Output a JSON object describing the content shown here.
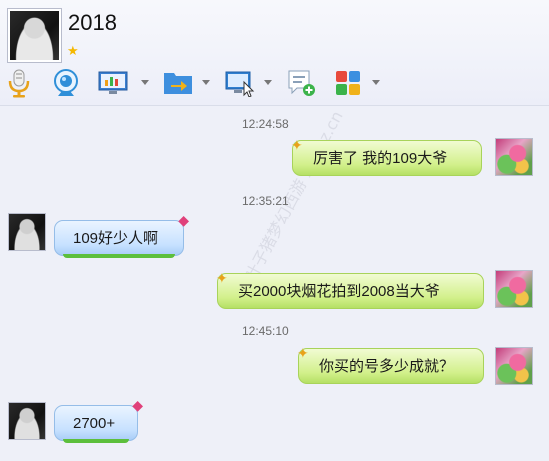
{
  "header": {
    "contact_name": "2018",
    "status_icon": "star-icon"
  },
  "toolbar": {
    "items": [
      {
        "name": "microphone-icon",
        "has_menu": false
      },
      {
        "name": "webcam-icon",
        "has_menu": false
      },
      {
        "name": "screen-share-icon",
        "has_menu": true
      },
      {
        "name": "send-file-icon",
        "has_menu": true
      },
      {
        "name": "remote-desktop-icon",
        "has_menu": true
      },
      {
        "name": "create-discussion-icon",
        "has_menu": false
      },
      {
        "name": "apps-icon",
        "has_menu": true
      }
    ]
  },
  "messages": [
    {
      "time": "12:24:58",
      "side": "right",
      "text": "厉害了  我的109大爷"
    },
    {
      "time": "12:35:21",
      "side": "left",
      "text": "109好少人啊"
    },
    {
      "time": "",
      "side": "right",
      "text": "买2000块烟花拍到2008当大爷"
    },
    {
      "time": "12:45:10",
      "side": "right",
      "text": "你买的号多少成就？"
    },
    {
      "time": "",
      "side": "left",
      "text": "2700+"
    }
  ],
  "watermark": "叶子猪梦幻西游 xy.yzz.cn",
  "colors": {
    "background": "#eef0f8",
    "green_bubble": "#d2f08b",
    "blue_bubble": "#c7e1ff"
  }
}
